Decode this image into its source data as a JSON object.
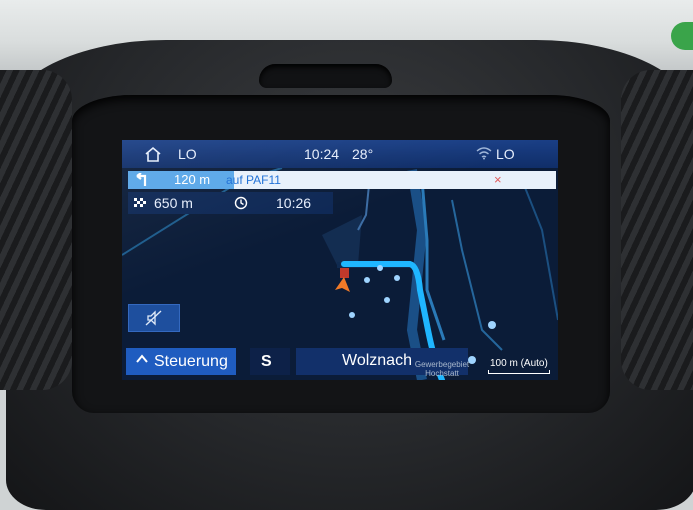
{
  "status_bar": {
    "left_label": "LO",
    "time": "10:24",
    "temperature": "28°",
    "right_label": "LO"
  },
  "maneuver": {
    "distance": "120 m",
    "road": "auf PAF11",
    "close": "×"
  },
  "trip": {
    "remaining_distance": "650 m",
    "arrival_time": "10:26"
  },
  "bottom_bar": {
    "steering_label": "Steuerung",
    "heading": "S",
    "city": "Wolznach",
    "area_label_line1": "Gewerbegebiet",
    "area_label_line2": "Hochstatt",
    "scale": "100 m (Auto)"
  },
  "icons": {
    "home": "home-icon",
    "wifi": "wifi-icon",
    "turn": "turn-left-icon",
    "flag": "checkered-flag-icon",
    "clock": "clock-icon",
    "mute": "mute-icon",
    "chevron": "chevron-up-icon"
  },
  "colors": {
    "route": "#1fb6ff",
    "header": "#1a3f86",
    "maneuver_bg": "#e8f1fb",
    "accent": "#1f5cc0",
    "close": "#e05a5a"
  }
}
